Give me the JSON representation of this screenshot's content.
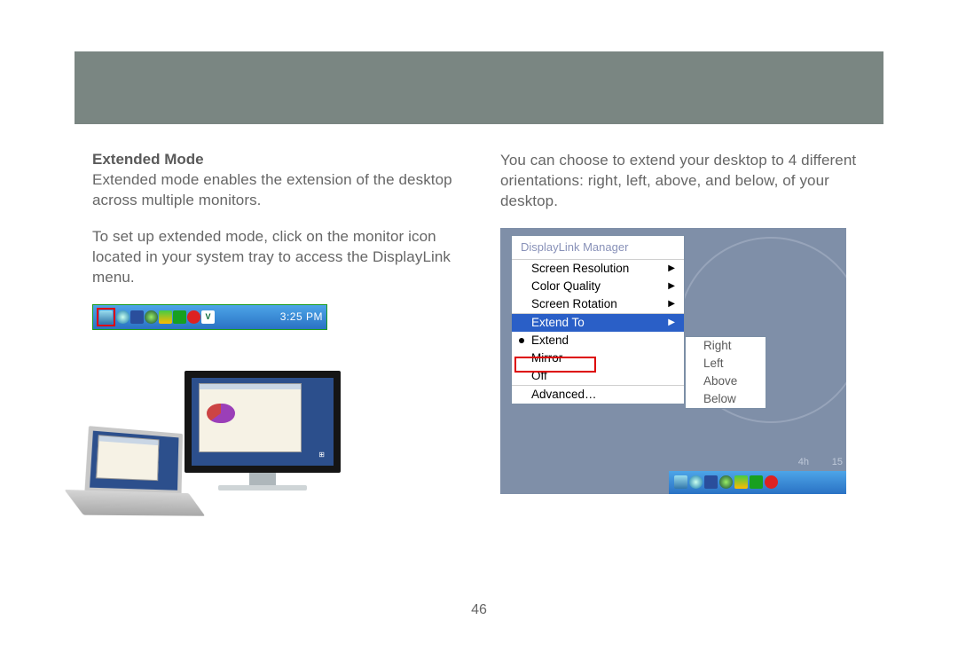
{
  "page_number": "46",
  "left_column": {
    "heading": "Extended Mode",
    "para1": "Extended mode enables the extension of the desktop across multiple monitors.",
    "para2": "To set up extended mode, click on the monitor icon located in your system tray to access the DisplayLink menu."
  },
  "right_column": {
    "para1": "You can choose to extend your desktop to 4 different orientations: right, left, above, and below, of your desktop."
  },
  "system_tray": {
    "time": "3:25 PM",
    "icons": [
      "monitor",
      "globe",
      "network",
      "clock",
      "shield",
      "people",
      "cancel",
      "va"
    ]
  },
  "displaylink_menu": {
    "title": "DisplayLink Manager",
    "items_top": [
      {
        "label": "Screen Resolution",
        "submenu": true
      },
      {
        "label": "Color Quality",
        "submenu": true
      },
      {
        "label": "Screen Rotation",
        "submenu": true
      }
    ],
    "items_mid": [
      {
        "label": "Extend To",
        "submenu": true,
        "highlighted": true
      },
      {
        "label": "Extend",
        "checked": true
      },
      {
        "label": "Mirror"
      },
      {
        "label": "Off"
      }
    ],
    "items_bottom": [
      {
        "label": "Advanced…"
      }
    ],
    "submenu": [
      "Right",
      "Left",
      "Above",
      "Below"
    ],
    "clock_labels": {
      "a": "4h",
      "b": "15"
    }
  }
}
